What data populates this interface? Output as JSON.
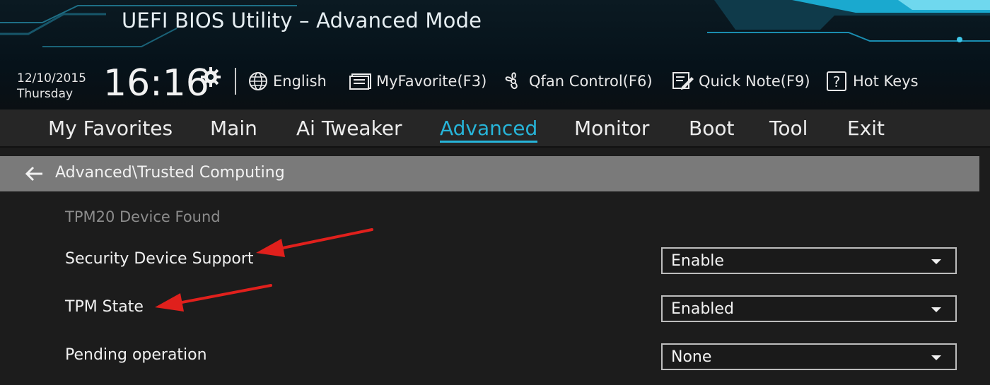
{
  "header": {
    "title": "UEFI BIOS Utility – Advanced Mode",
    "date": "12/10/2015",
    "day": "Thursday",
    "time": "16:16",
    "tools": [
      {
        "label": "English",
        "icon": "globe-icon"
      },
      {
        "label": "MyFavorite(F3)",
        "icon": "favorites-icon"
      },
      {
        "label": "Qfan Control(F6)",
        "icon": "fan-icon"
      },
      {
        "label": "Quick Note(F9)",
        "icon": "note-icon"
      },
      {
        "label": "Hot Keys",
        "icon": "help-icon"
      }
    ]
  },
  "nav": {
    "tabs": [
      {
        "label": "My Favorites"
      },
      {
        "label": "Main"
      },
      {
        "label": "Ai Tweaker"
      },
      {
        "label": "Advanced"
      },
      {
        "label": "Monitor"
      },
      {
        "label": "Boot"
      },
      {
        "label": "Tool"
      },
      {
        "label": "Exit"
      }
    ],
    "active": "Advanced"
  },
  "breadcrumb": "Advanced\\Trusted Computing",
  "content": {
    "status": "TPM20 Device Found",
    "settings": [
      {
        "label": "Security Device Support",
        "value": "Enable"
      },
      {
        "label": "TPM State",
        "value": "Enabled"
      },
      {
        "label": "Pending operation",
        "value": "None"
      }
    ]
  },
  "colors": {
    "accent": "#27b4d8",
    "annotation": "#e0201c"
  }
}
